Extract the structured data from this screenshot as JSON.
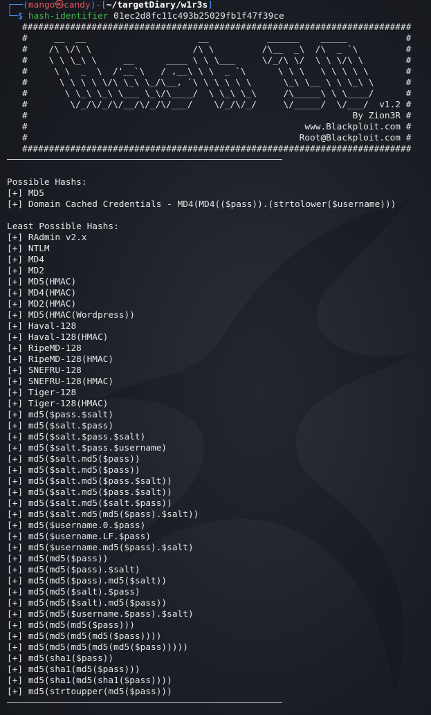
{
  "prompt": {
    "corner": "┌──(",
    "user": "mango",
    "at": "㉿",
    "host": "candy",
    "mid": ")-[",
    "path": "~/targetDiary/w1r3s",
    "close": "]",
    "dollar_prefix": "└─",
    "dollar": "$",
    "command": "hash-identifier",
    "argument": "01ec2d8fc11c493b25029fb1f47f39ce"
  },
  "banner": [
    "#########################################################################",
    "#     __  __                     __           ______    _____           #",
    "#    /\\ \\/\\ \\                   /\\ \\         /\\__  _\\  /\\  _ `\\         #",
    "#    \\ \\ \\_\\ \\     __      ____ \\ \\ \\___     \\/_/\\ \\/  \\ \\ \\/\\ \\        #",
    "#     \\ \\  _  \\  /'__`\\   / ,__\\ \\ \\  _ `\\      \\ \\ \\   \\ \\ \\ \\ \\       #",
    "#      \\ \\ \\ \\ \\/\\ \\_\\ \\_/\\__, `\\ \\ \\ \\ \\ \\      \\_\\ \\__ \\ \\ \\_\\ \\      #",
    "#       \\ \\_\\ \\_\\ \\___ \\_\\/\\____/  \\ \\_\\ \\_\\     /\\_____\\ \\ \\____/      #",
    "#        \\/_/\\/_/\\/__/\\/_/\\/___/    \\/_/\\/_/     \\/_____/  \\/___/  v1.2 #",
    "#                                                             By Zion3R #",
    "#                                                    www.Blackploit.com #",
    "#                                                   Root@Blackploit.com #",
    "#########################################################################"
  ],
  "possible_header": "Possible Hashs:",
  "possible": [
    "[+] MD5",
    "[+] Domain Cached Credentials - MD4(MD4(($pass)).(strtolower($username)))"
  ],
  "least_header": "Least Possible Hashs:",
  "least": [
    "[+] RAdmin v2.x",
    "[+] NTLM",
    "[+] MD4",
    "[+] MD2",
    "[+] MD5(HMAC)",
    "[+] MD4(HMAC)",
    "[+] MD2(HMAC)",
    "[+] MD5(HMAC(Wordpress))",
    "[+] Haval-128",
    "[+] Haval-128(HMAC)",
    "[+] RipeMD-128",
    "[+] RipeMD-128(HMAC)",
    "[+] SNEFRU-128",
    "[+] SNEFRU-128(HMAC)",
    "[+] Tiger-128",
    "[+] Tiger-128(HMAC)",
    "[+] md5($pass.$salt)",
    "[+] md5($salt.$pass)",
    "[+] md5($salt.$pass.$salt)",
    "[+] md5($salt.$pass.$username)",
    "[+] md5($salt.md5($pass))",
    "[+] md5($salt.md5($pass))",
    "[+] md5($salt.md5($pass.$salt))",
    "[+] md5($salt.md5($pass.$salt))",
    "[+] md5($salt.md5($salt.$pass))",
    "[+] md5($salt.md5(md5($pass).$salt))",
    "[+] md5($username.0.$pass)",
    "[+] md5($username.LF.$pass)",
    "[+] md5($username.md5($pass).$salt)",
    "[+] md5(md5($pass))",
    "[+] md5(md5($pass).$salt)",
    "[+] md5(md5($pass).md5($salt))",
    "[+] md5(md5($salt).$pass)",
    "[+] md5(md5($salt).md5($pass))",
    "[+] md5(md5($username.$pass).$salt)",
    "[+] md5(md5(md5($pass)))",
    "[+] md5(md5(md5(md5($pass))))",
    "[+] md5(md5(md5(md5(md5($pass)))))",
    "[+] md5(sha1($pass))",
    "[+] md5(sha1(md5($pass)))",
    "[+] md5(sha1(md5(sha1($pass))))",
    "[+] md5(strtoupper(md5($pass)))"
  ],
  "colors": {
    "background": "#1b1e25",
    "prompt_blue": "#4a8cf7",
    "user_red": "#e05561",
    "command_green": "#3fb950",
    "text": "#e6e6e6"
  }
}
